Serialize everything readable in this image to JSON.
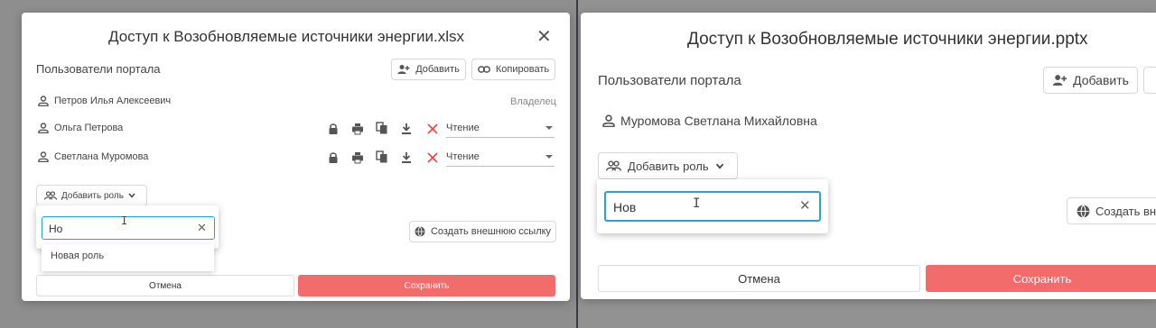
{
  "left_dialog": {
    "title": "Доступ к Возобновляемые источники энергии.xlsx",
    "section_label": "Пользователи портала",
    "add_button": "Добавить",
    "copy_button": "Копировать",
    "users": [
      {
        "name": "Петров Илья Алексеевич",
        "role": "Владелец"
      },
      {
        "name": "Ольга Петрова",
        "permission": "Чтение"
      },
      {
        "name": "Светлана Муромова",
        "permission": "Чтение"
      }
    ],
    "add_role_button": "Добавить роль",
    "role_search": {
      "value": "Но"
    },
    "role_suggestion": "Новая роль",
    "external_link_button": "Создать внешнюю ссылку",
    "cancel_button": "Отмена",
    "save_button": "Сохранить"
  },
  "right_dialog": {
    "title": "Доступ к Возобновляемые источники энергии.pptx",
    "section_label": "Пользователи портала",
    "add_button": "Добавить",
    "users": [
      {
        "name": "Муромова Светлана Михайловна"
      }
    ],
    "add_role_button": "Добавить роль",
    "role_search": {
      "value": "Нов"
    },
    "external_link_button": "Создать вне",
    "cancel_button": "Отмена",
    "save_button": "Сохранить"
  },
  "colors": {
    "accent_red": "#f36c6c",
    "focus_blue": "#2aa0d8",
    "remove_red": "#e64a4a",
    "background_gray": "#8f8f8f"
  },
  "icons": [
    "close-icon",
    "add-user-icon",
    "link-icon",
    "person-icon",
    "lock-icon",
    "print-icon",
    "copy-icon",
    "download-icon",
    "remove-icon",
    "group-icon",
    "chevron-down-icon",
    "globe-icon",
    "text-cursor-icon"
  ]
}
